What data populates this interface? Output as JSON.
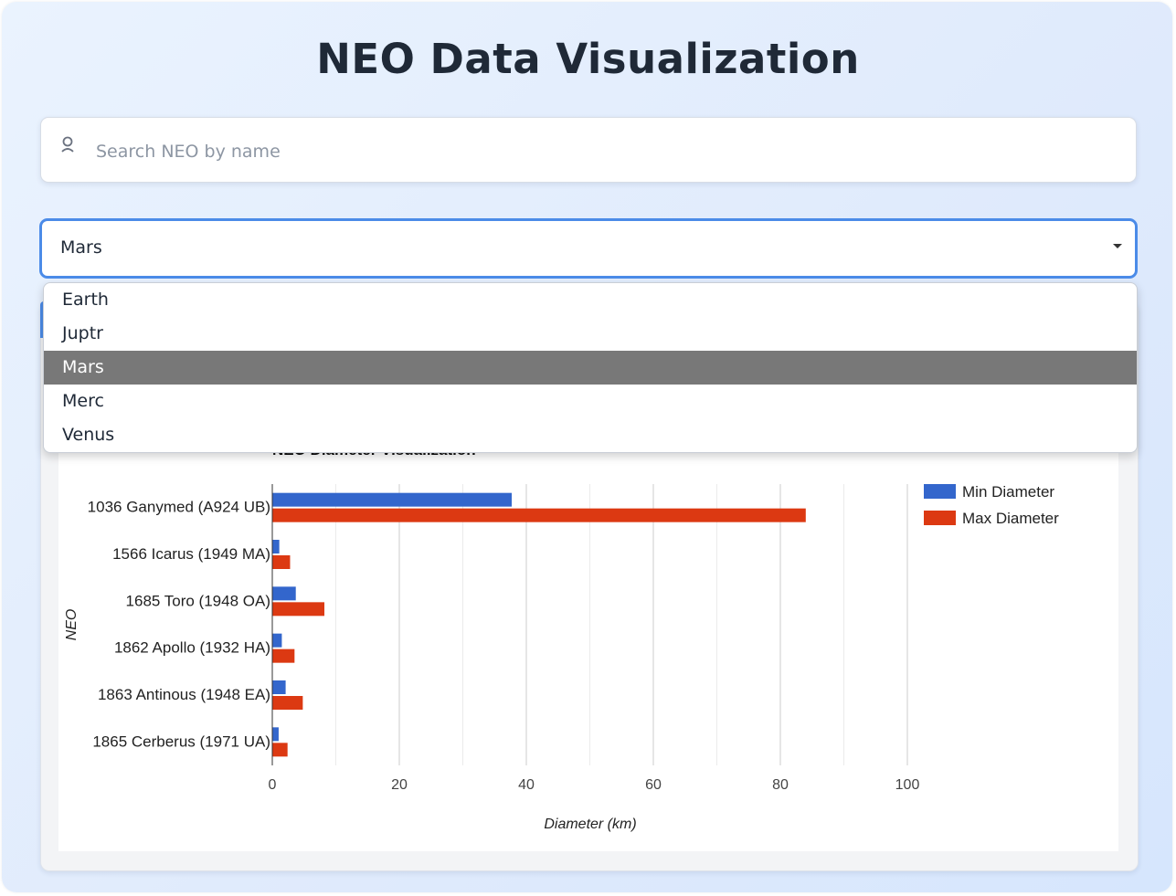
{
  "page": {
    "title": "NEO Data Visualization"
  },
  "search": {
    "placeholder": "Search NEO by name",
    "icon": "user-icon"
  },
  "filter": {
    "selected": "Mars",
    "options": [
      "Earth",
      "Juptr",
      "Mars",
      "Merc",
      "Venus"
    ],
    "highlighted_index": 2
  },
  "colors": {
    "accent": "#4b8be8",
    "min_series": "#3366cc",
    "max_series": "#dc3912",
    "option_highlight": "#787878"
  },
  "chart_data": {
    "type": "bar",
    "orientation": "horizontal",
    "title": "NEO Diameter Visualization",
    "xlabel": "Diameter (km)",
    "ylabel": "NEO",
    "categories": [
      "1036 Ganymed (A924 UB)",
      "1566 Icarus (1949 MA)",
      "1685 Toro (1948 OA)",
      "1862 Apollo (1932 HA)",
      "1863 Antinous (1948 EA)",
      "1865 Cerberus (1971 UA)"
    ],
    "series": [
      {
        "name": "Min Diameter",
        "values": [
          37.7,
          1.1,
          3.7,
          1.5,
          2.1,
          1.0
        ]
      },
      {
        "name": "Max Diameter",
        "values": [
          84.0,
          2.8,
          8.2,
          3.5,
          4.8,
          2.4
        ]
      }
    ],
    "xlim": [
      0,
      100
    ],
    "xticks": [
      0,
      20,
      40,
      60,
      80,
      100
    ],
    "grid": true,
    "legend_position": "right"
  }
}
